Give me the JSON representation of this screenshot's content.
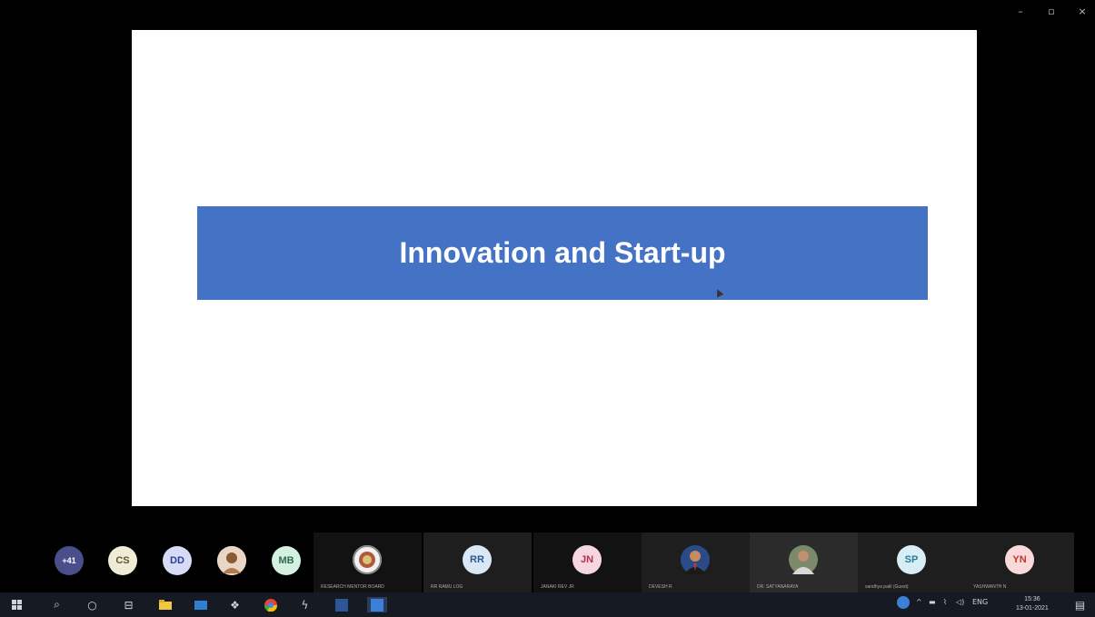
{
  "window": {
    "controls": {
      "minimize": "–",
      "maximize": "▫",
      "close": "×"
    }
  },
  "slide": {
    "title": "Innovation and Start-up",
    "band_color": "#4472c4"
  },
  "participants": {
    "overflow_count": "+41",
    "small": [
      {
        "initials": "CS",
        "bg": "#f0ebd5",
        "fg": "#5e5630"
      },
      {
        "initials": "DD",
        "bg": "#d6dcf7",
        "fg": "#2d3f8c"
      },
      {
        "initials": "",
        "bg": "#b07a50",
        "fg": "#ffffff",
        "photo": true
      },
      {
        "initials": "MB",
        "bg": "#d4f0e0",
        "fg": "#2d6a48"
      }
    ],
    "tiles": [
      {
        "initials": "",
        "label": "RESEARCH MENTOR BOARD",
        "photo": "seal"
      },
      {
        "initials": "RR",
        "label": "RR RAMU LOG",
        "bg": "#d9e8f7",
        "fg": "#2c5a8a"
      },
      {
        "initials": "JN",
        "label": "JANAKI REV JR",
        "bg": "#f7d6e0",
        "fg": "#b0304d"
      },
      {
        "initials": "",
        "label": "DEVESH R",
        "photo": "person"
      },
      {
        "initials": "",
        "label": "DR. SATYANARAYA",
        "photo": "person2"
      },
      {
        "initials": "SP",
        "label": "sandhya patil (Guest)",
        "bg": "#d8eef5",
        "fg": "#2b7a99"
      },
      {
        "initials": "YN",
        "label": "YASHWANTH N",
        "bg": "#f9d9d9",
        "fg": "#c0392b"
      }
    ]
  },
  "taskbar": {
    "icons": [
      "windows-icon",
      "search-icon",
      "cortana-icon",
      "task-view-icon",
      "file-explorer-icon",
      "mail-icon",
      "dropbox-icon",
      "chrome-icon",
      "app-icon",
      "word-icon",
      "teams-icon"
    ],
    "tray": {
      "lang": "ENG"
    },
    "clock": {
      "time": "15:36",
      "date": "13-01-2021"
    }
  }
}
